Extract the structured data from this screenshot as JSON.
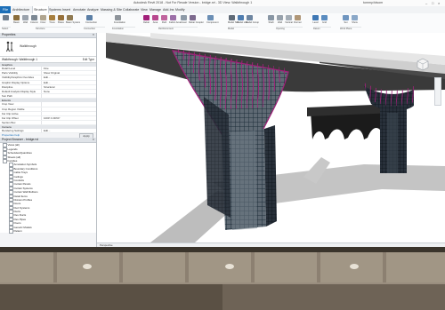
{
  "window": {
    "title": "Autodesk Revit 2018 - Not For Resale Version - bridge.rvt - 3D View: Walkthrough 1",
    "user": "tommy.folsom"
  },
  "tabs": [
    "Architecture",
    "Structure",
    "Systems",
    "Insert",
    "Annotate",
    "Analyze",
    "Massing & Site",
    "Collaborate",
    "View",
    "Manage",
    "Add-Ins",
    "Modify"
  ],
  "file_tab": "File",
  "ribbon": {
    "buttons": [
      "Beam",
      "Wall",
      "Column",
      "Floor",
      "Truss",
      "Brace",
      "Beam System",
      "Connection",
      "Foundation",
      "Rebar",
      "Area",
      "Path",
      "Fabric Area",
      "Cover",
      "Rebar Coupler",
      "Component",
      "Model Text",
      "Model Line",
      "Model Group",
      "Shaft",
      "Wall",
      "Vertical",
      "Dormer",
      "Level",
      "Grid",
      "Set",
      "Show"
    ],
    "groups": [
      "Select",
      "Structure",
      "Connection",
      "Foundation",
      "Reinforcement",
      "Model",
      "Opening",
      "Datum",
      "Work Plane"
    ]
  },
  "properties": {
    "header": "Properties",
    "type_label": "Walkthrough",
    "selector": "Walkthrough: Walkthrough 1",
    "edit_type": "Edit Type",
    "sections": {
      "graphics": "Graphics",
      "extents": "Extents",
      "camera": "Camera"
    },
    "graphics_rows": [
      {
        "key": "Detail Level",
        "value": "Fine"
      },
      {
        "key": "Parts Visibility",
        "value": "Show Original"
      },
      {
        "key": "Visibility/Graphics Overrides",
        "value": "Edit..."
      },
      {
        "key": "Graphic Display Options",
        "value": "Edit..."
      },
      {
        "key": "Discipline",
        "value": "Structural"
      },
      {
        "key": "Default Analysis Display Style",
        "value": "None"
      },
      {
        "key": "Sun Path",
        "value": ""
      }
    ],
    "extents_rows": [
      {
        "key": "Crop View",
        "value": ""
      },
      {
        "key": "Crop Region Visible",
        "value": ""
      },
      {
        "key": "Far Clip Active",
        "value": ""
      },
      {
        "key": "Far Clip Offset",
        "value": "1000' 0 23/64\""
      },
      {
        "key": "Section Box",
        "value": ""
      }
    ],
    "camera_rows": [
      {
        "key": "Rendering Settings",
        "value": "Edit..."
      }
    ],
    "help_link": "Properties help",
    "apply": "Apply"
  },
  "browser": {
    "header": "Project Browser - bridge.rvt",
    "items": [
      "Views (all)",
      "Legends",
      "Schedules/Quantities",
      "Sheets (all)",
      "Families",
      "Annotation Symbols",
      "Boundary Conditions",
      "Cable Trays",
      "Ceilings",
      "Conduits",
      "Curtain Panels",
      "Curtain Systems",
      "Curtain Wall Mullions",
      "Detail Items",
      "Division Profiles",
      "Doors",
      "Duct Systems",
      "Ducts",
      "Flex Ducts",
      "Flex Pipes",
      "Floors",
      "Generic Models",
      "Pattern"
    ]
  },
  "status": {
    "view": "Perspective"
  },
  "colors": {
    "ribbon_accent": "#1c6fb8",
    "rebar_magenta": "#a2207a",
    "rebar_blue": "#2d4a63",
    "shadow": "#c4c4c4"
  }
}
